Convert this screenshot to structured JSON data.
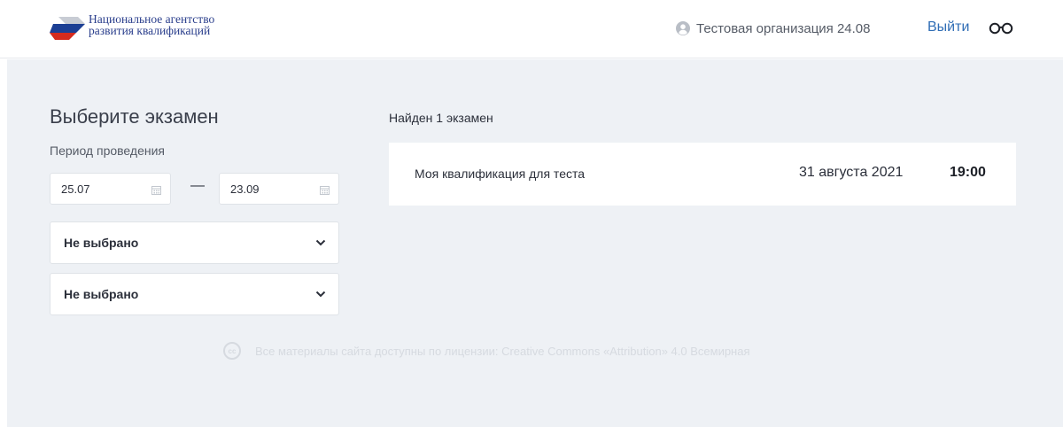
{
  "header": {
    "logo_line1": "Национальное агентство",
    "logo_line2": "развития квалификаций",
    "user_icon": "user-circle-icon",
    "user_name": "Тестовая организация 24.08",
    "logout_label": "Выйти",
    "accessibility_icon": "glasses-icon"
  },
  "filters": {
    "title": "Выберите экзамен",
    "period_label": "Период проведения",
    "date_from": "25.07",
    "date_to": "23.09",
    "date_separator": "—",
    "calendar_icon": "calendar-icon",
    "select1_value": "Не выбрано",
    "select2_value": "Не выбрано",
    "chevron_icon": "chevron-down-icon"
  },
  "results": {
    "count_text": "Найден 1 экзамен",
    "exams": [
      {
        "name": "Моя квалификация для теста",
        "date": "31 августа 2021",
        "time": "19:00"
      }
    ]
  },
  "footer": {
    "license_icon": "creative-commons-icon",
    "license_text": "Все материалы сайта доступны по лицензии: Creative Commons «Attribution» 4.0 Всемирная"
  },
  "colors": {
    "background": "#eef1f5",
    "link": "#2f6db5",
    "logo_text": "#2a3e8c",
    "logo_blue": "#1c3f94",
    "logo_red": "#d52b1e"
  }
}
